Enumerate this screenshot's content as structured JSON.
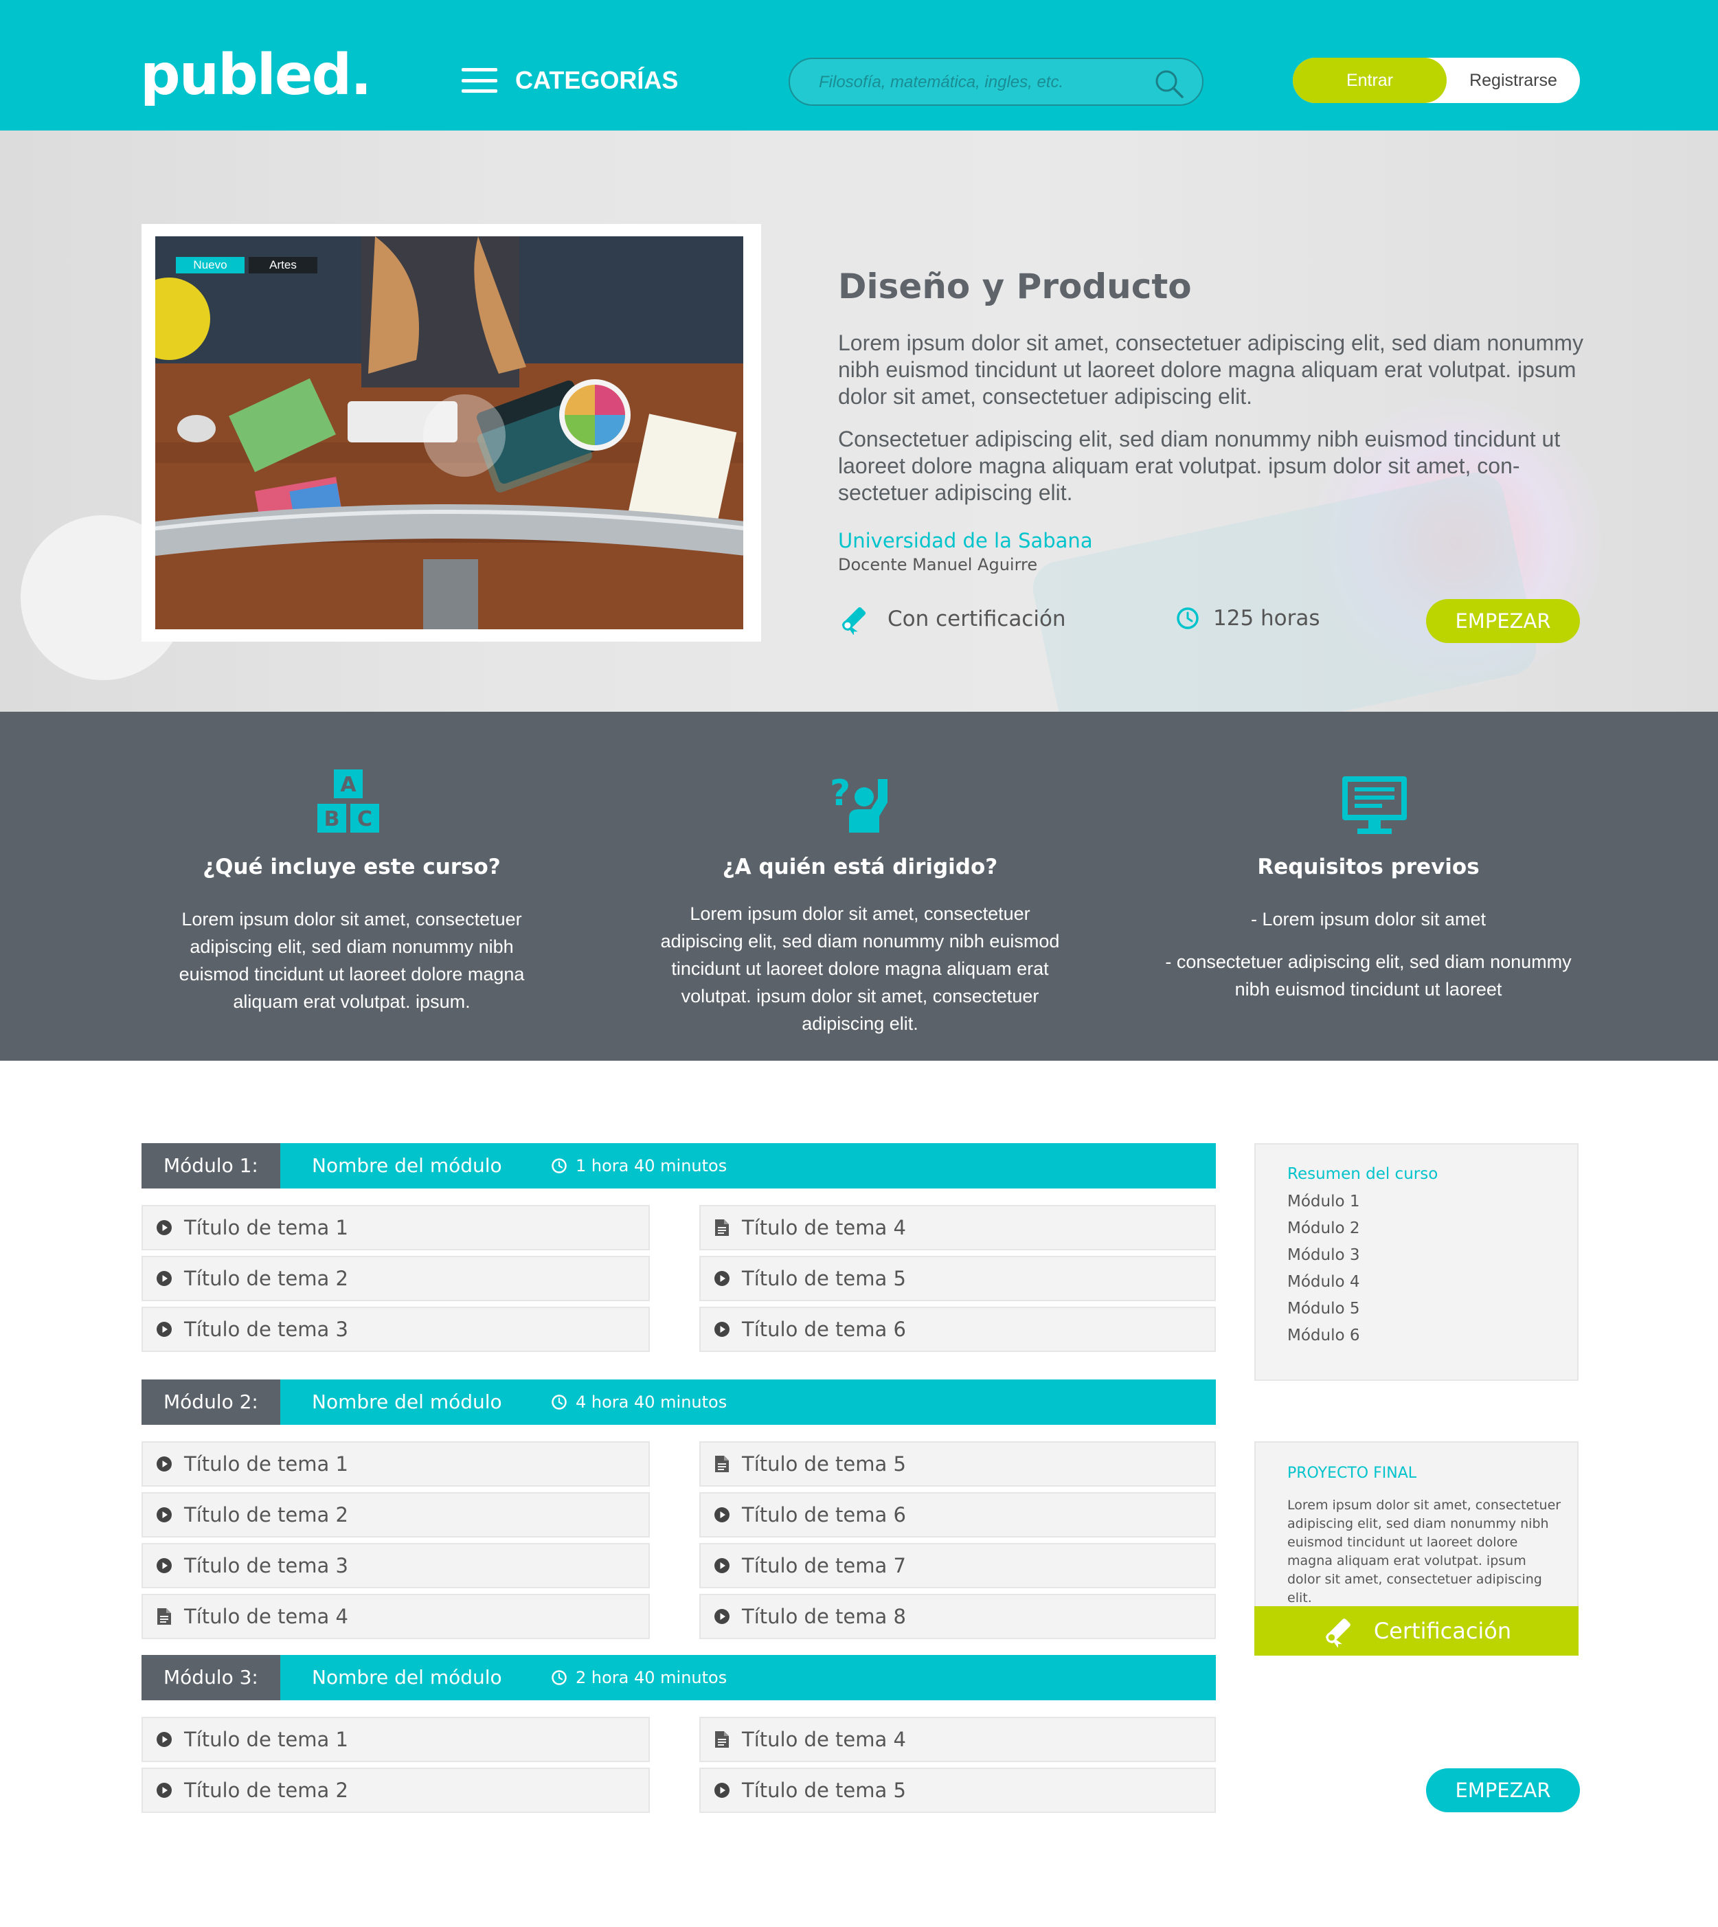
{
  "header": {
    "logo": "publed.",
    "categories_label": "CATEGORÍAS",
    "search_placeholder": "Filosofía, matemática, ingles, etc.",
    "login_label": "Entrar",
    "register_label": "Registrarse"
  },
  "hero": {
    "tag_new": "Nuevo",
    "tag_category": "Artes",
    "title": "Diseño y Producto",
    "paragraph_1": "Lorem ipsum dolor sit amet, consectetuer adipiscing elit, sed diam nonummy nibh euismod tincidunt ut laoreet dolore magna aliquam erat volutpat. ipsum dolor sit amet, consectetuer adipiscing elit.",
    "paragraph_2": "Consectetuer adipiscing elit, sed diam nonummy nibh euismod tincidunt ut laoreet dolore magna aliquam erat volutpat. ipsum dolor sit amet, con-sectetuer adipiscing elit.",
    "university": "Universidad de la Sabana",
    "teacher": "Docente Manuel Aguirre",
    "certification": "Con certificación",
    "hours": "125 horas",
    "start_label": "EMPEZAR"
  },
  "info": {
    "includes": {
      "title": "¿Qué incluye este curso?",
      "text": "Lorem ipsum dolor sit amet, consectetuer adipiscing elit, sed diam nonummy nibh euismod tincidunt ut laoreet dolore magna aliquam erat volutpat. ipsum."
    },
    "audience": {
      "title": "¿A quién está dirigido?",
      "text": "Lorem ipsum dolor sit amet, consectetuer adipiscing elit, sed diam nonummy nibh euismod tincidunt ut laoreet dolore magna aliquam erat volutpat. ipsum dolor sit amet, consectetuer adipiscing elit."
    },
    "requirements": {
      "title": "Requisitos previos",
      "item_1": "- Lorem ipsum dolor sit amet",
      "item_2": "- consectetuer adipiscing elit, sed diam nonummy nibh euismod tincidunt ut laoreet"
    }
  },
  "modules": [
    {
      "label": "Módulo 1:",
      "name": "Nombre del módulo",
      "duration": "1 hora 40 minutos",
      "left": [
        "Título de tema 1",
        "Título de tema 2",
        "Título de tema 3"
      ],
      "right": [
        "Título de tema 4",
        "Título de tema 5",
        "Título de tema 6"
      ]
    },
    {
      "label": "Módulo 2:",
      "name": "Nombre del módulo",
      "duration": "4 hora 40 minutos",
      "left": [
        "Título de tema 1",
        "Título de tema 2",
        "Título de tema 3",
        "Título de tema 4"
      ],
      "right": [
        "Título de tema 5",
        "Título de tema 6",
        "Título de tema 7",
        "Título de tema 8"
      ]
    },
    {
      "label": "Módulo 3:",
      "name": "Nombre del módulo",
      "duration": "2 hora 40 minutos",
      "left": [
        "Título de tema 1",
        "Título de tema 2"
      ],
      "right": [
        "Título de tema 4",
        "Título de tema 5"
      ]
    }
  ],
  "summary": {
    "title": "Resumen del curso",
    "items": [
      "Módulo 1",
      "Módulo 2",
      "Módulo 3",
      "Módulo 4",
      "Módulo 5",
      "Módulo 6"
    ]
  },
  "final_project": {
    "title": "PROYECTO FINAL",
    "text": "Lorem ipsum dolor sit amet, consectetuer adipiscing elit, sed diam nonummy nibh euismod tincidunt ut laoreet dolore magna aliquam erat volutpat. ipsum dolor sit amet, consectetuer adipiscing elit.",
    "cert_label": "Certificación"
  },
  "bottom": {
    "start_label": "EMPEZAR"
  },
  "colors": {
    "brand": "#00c3cb",
    "accent": "#bcd400",
    "dark": "#5b6269"
  },
  "icons": {
    "topic_types": {
      "m1": {
        "left": [
          "play",
          "play",
          "play"
        ],
        "right": [
          "doc",
          "play",
          "play"
        ]
      },
      "m2": {
        "left": [
          "play",
          "play",
          "play",
          "doc"
        ],
        "right": [
          "doc",
          "play",
          "play",
          "play"
        ]
      },
      "m3": {
        "left": [
          "play",
          "play"
        ],
        "right": [
          "doc",
          "play"
        ]
      }
    }
  }
}
